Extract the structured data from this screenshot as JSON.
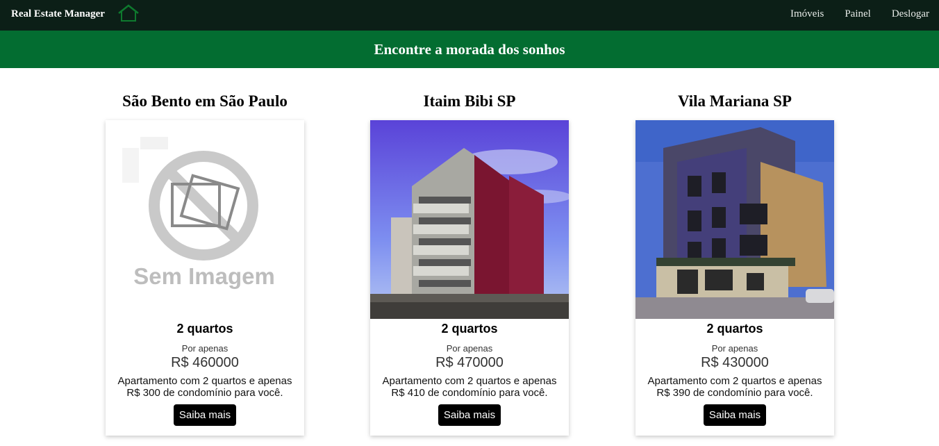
{
  "navbar": {
    "brand": "Real Estate Manager",
    "logo_icon": "house-icon",
    "links": [
      "Imóveis",
      "Painel",
      "Deslogar"
    ]
  },
  "hero": {
    "title": "Encontre a morada dos sonhos"
  },
  "listings": [
    {
      "title": "São Bento em São Paulo",
      "image": "no-image-placeholder",
      "image_text": "Sem Imagem",
      "rooms": "2 quartos",
      "price_prefix": "Por apenas",
      "price": "R$ 460000",
      "description": "Apartamento com 2 quartos e apenas R$ 300 de condomínio para você.",
      "button": "Saiba mais"
    },
    {
      "title": "Itaim Bibi SP",
      "image": "building-photo",
      "rooms": "2 quartos",
      "price_prefix": "Por apenas",
      "price": "R$ 470000",
      "description": "Apartamento com 2 quartos e apenas R$ 410 de condomínio para você.",
      "button": "Saiba mais"
    },
    {
      "title": "Vila Mariana SP",
      "image": "building-photo",
      "rooms": "2 quartos",
      "price_prefix": "Por apenas",
      "price": "R$ 430000",
      "description": "Apartamento com 2 quartos e apenas R$ 390 de condomínio para você.",
      "button": "Saiba mais"
    }
  ],
  "colors": {
    "navbar": "#0c1f17",
    "hero": "#036d31",
    "button": "#000000"
  }
}
